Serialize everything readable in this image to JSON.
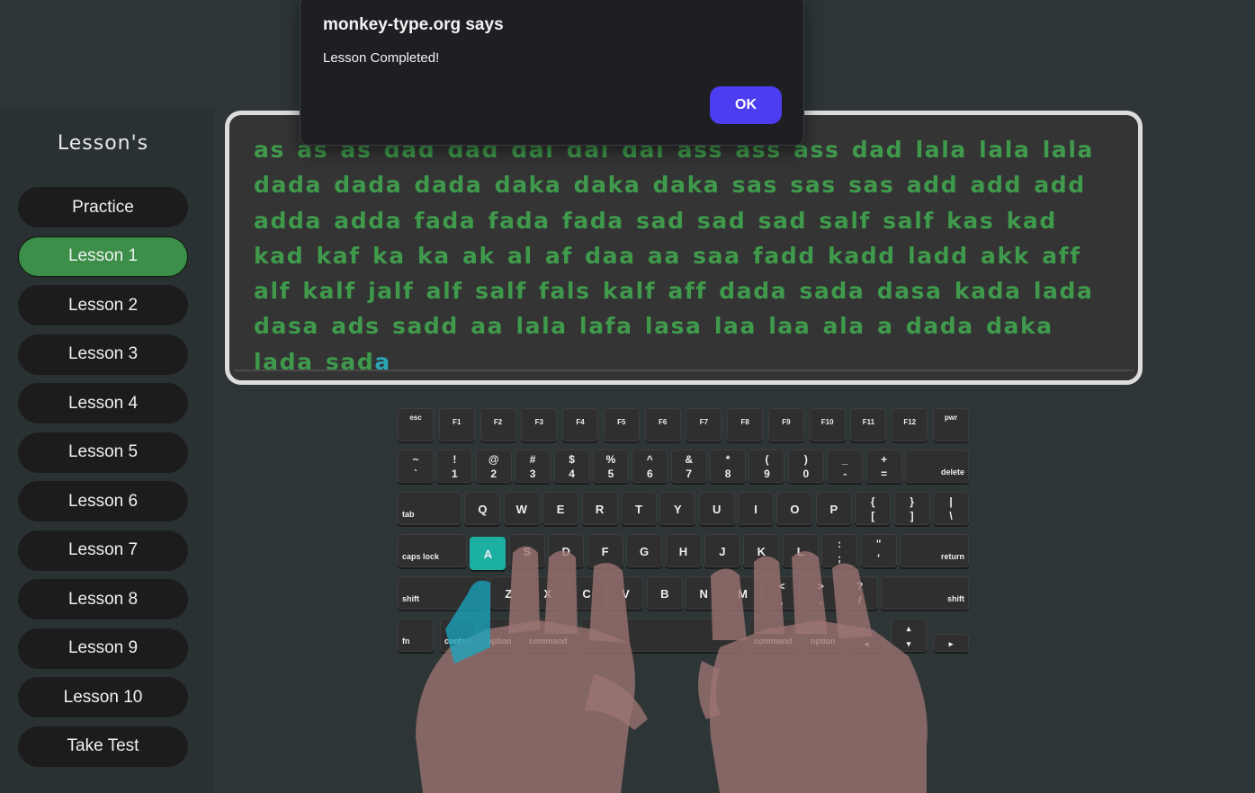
{
  "sidebar": {
    "title": "Lesson's",
    "items": [
      {
        "label": "Practice",
        "active": false
      },
      {
        "label": "Lesson 1",
        "active": true
      },
      {
        "label": "Lesson 2",
        "active": false
      },
      {
        "label": "Lesson 3",
        "active": false
      },
      {
        "label": "Lesson 4",
        "active": false
      },
      {
        "label": "Lesson 5",
        "active": false
      },
      {
        "label": "Lesson 6",
        "active": false
      },
      {
        "label": "Lesson 7",
        "active": false
      },
      {
        "label": "Lesson 8",
        "active": false
      },
      {
        "label": "Lesson 9",
        "active": false
      },
      {
        "label": "Lesson 10",
        "active": false
      },
      {
        "label": "Take Test",
        "active": false
      }
    ]
  },
  "typing": {
    "typed_text": "as as as dad dad dal dal dal ass ass ass dad lala lala lala dada dada dada daka daka daka sas sas sas add add add adda adda fada fada fada sad sad sad salf salf kas kad kad kaf ka ka ak al af daa aa saa fadd kadd ladd akk aff alf kalf jalf alf salf fals kalf aff dada sada dasa kada lada dasa ads sadd aa lala lafa lasa laa laa ala a dada daka lada sad",
    "cursor_char": "a",
    "typed_color": "#3f9a4c",
    "cursor_color": "#2aa5b5"
  },
  "keyboard": {
    "highlight_key": "A",
    "highlight_color": "#1cb0a2",
    "rows": [
      [
        [
          "esc"
        ],
        [
          "F1"
        ],
        [
          "F2"
        ],
        [
          "F3"
        ],
        [
          "F4"
        ],
        [
          "F5"
        ],
        [
          "F6"
        ],
        [
          "F7"
        ],
        [
          "F8"
        ],
        [
          "F9"
        ],
        [
          "F10"
        ],
        [
          "F11"
        ],
        [
          "F12"
        ],
        [
          "pwr"
        ]
      ],
      [
        [
          "~",
          "`"
        ],
        [
          "!",
          "1"
        ],
        [
          "@",
          "2"
        ],
        [
          "#",
          "3"
        ],
        [
          "$",
          "4"
        ],
        [
          "%",
          "5"
        ],
        [
          "^",
          "6"
        ],
        [
          "&",
          "7"
        ],
        [
          "*",
          "8"
        ],
        [
          "(",
          "9"
        ],
        [
          ")",
          "0"
        ],
        [
          "_",
          "-"
        ],
        [
          "+",
          "="
        ],
        [
          "delete"
        ]
      ],
      [
        [
          "tab"
        ],
        [
          "Q"
        ],
        [
          "W"
        ],
        [
          "E"
        ],
        [
          "R"
        ],
        [
          "T"
        ],
        [
          "Y"
        ],
        [
          "U"
        ],
        [
          "I"
        ],
        [
          "O"
        ],
        [
          "P"
        ],
        [
          "{",
          "["
        ],
        [
          "}",
          "]"
        ],
        [
          "|",
          "\\"
        ]
      ],
      [
        [
          "caps lock"
        ],
        [
          "A"
        ],
        [
          "S"
        ],
        [
          "D"
        ],
        [
          "F"
        ],
        [
          "G"
        ],
        [
          "H"
        ],
        [
          "J"
        ],
        [
          "K"
        ],
        [
          "L"
        ],
        [
          ":",
          ";"
        ],
        [
          "\"",
          "'"
        ],
        [
          "return"
        ]
      ],
      [
        [
          "shift"
        ],
        [
          "Z"
        ],
        [
          "X"
        ],
        [
          "C"
        ],
        [
          "V"
        ],
        [
          "B"
        ],
        [
          "N"
        ],
        [
          "M"
        ],
        [
          "<",
          ","
        ],
        [
          ">",
          "."
        ],
        [
          "?",
          "/"
        ],
        [
          "shift"
        ]
      ],
      [
        [
          "fn"
        ],
        [
          "control"
        ],
        [
          "option"
        ],
        [
          "command"
        ],
        [
          ""
        ],
        [
          "command"
        ],
        [
          "option"
        ],
        [
          "◂"
        ],
        [
          "▴",
          "▾"
        ],
        [
          "▸"
        ]
      ]
    ]
  },
  "dialog": {
    "title": "monkey-type.org says",
    "message": "Lesson Completed!",
    "ok_label": "OK",
    "ok_color": "#4c3df0"
  },
  "icons": {
    "hands": "hands-overlay-icon"
  }
}
